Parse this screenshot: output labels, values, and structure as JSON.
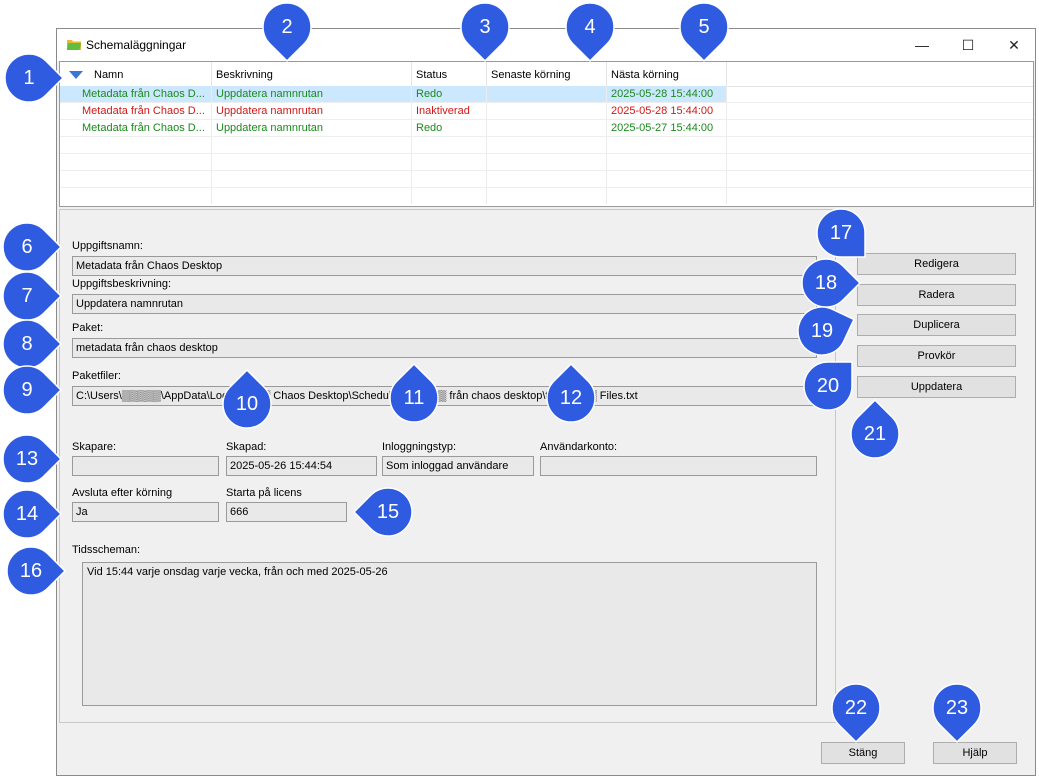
{
  "window": {
    "title": "Schemaläggningar",
    "controls": [
      "—",
      "☐",
      "✕"
    ]
  },
  "list": {
    "headers": [
      "Namn",
      "Beskrivning",
      "Status",
      "Senaste körning",
      "Nästa körning"
    ],
    "rows": [
      {
        "name": "Metadata från Chaos D...",
        "desc": "Uppdatera namnrutan",
        "status": "Redo",
        "last": "",
        "next": "2025-05-28 15:44:00",
        "color": "#1a8a1a"
      },
      {
        "name": "Metadata från Chaos D...",
        "desc": "Uppdatera namnrutan",
        "status": "Inaktiverad",
        "last": "",
        "next": "2025-05-28 15:44:00",
        "color": "#d01818"
      },
      {
        "name": "Metadata från Chaos D...",
        "desc": "Uppdatera namnrutan",
        "status": "Redo",
        "last": "",
        "next": "2025-05-27 15:44:00",
        "color": "#1a8a1a"
      }
    ],
    "selected_row_color": "#cce8ff"
  },
  "details": {
    "task_name_label": "Uppgiftsnamn:",
    "task_name": "Metadata från Chaos Desktop",
    "task_desc_label": "Uppgiftsbeskrivning:",
    "task_desc": "Uppdatera namnrutan",
    "package_label": "Paket:",
    "package": "metadata från chaos desktop",
    "package_files_label": "Paketfiler:",
    "package_files": "C:\\Users\\▒▒▒▒▒\\AppData\\Local\\▒▒▒▒ Chaos Desktop\\Schedules\\m▒▒▒▒ från chaos desktop\\task▒▒▒▒ Files.txt",
    "creator_label": "Skapare:",
    "creator": "",
    "created_label": "Skapad:",
    "created": "2025-05-26 15:44:54",
    "login_type_label": "Inloggningstyp:",
    "login_type": "Som inloggad användare",
    "user_account_label": "Användarkonto:",
    "user_account": "",
    "exit_after_label": "Avsluta efter körning",
    "exit_after": "Ja",
    "start_on_license_label": "Starta på licens",
    "start_on_license": "666",
    "schedules_label": "Tidsscheman:",
    "schedules": "Vid 15:44 varje onsdag varje vecka, från och med 2025-05-26"
  },
  "buttons": {
    "edit": "Redigera",
    "delete": "Radera",
    "duplicate": "Duplicera",
    "test_run": "Provkör",
    "update": "Uppdatera",
    "close": "Stäng",
    "help": "Hjälp"
  },
  "callouts": [
    "1",
    "2",
    "3",
    "4",
    "5",
    "6",
    "7",
    "8",
    "9",
    "10",
    "11",
    "12",
    "13",
    "14",
    "15",
    "16",
    "17",
    "18",
    "19",
    "20",
    "21",
    "22",
    "23"
  ],
  "callout_color": "#2f5be0"
}
